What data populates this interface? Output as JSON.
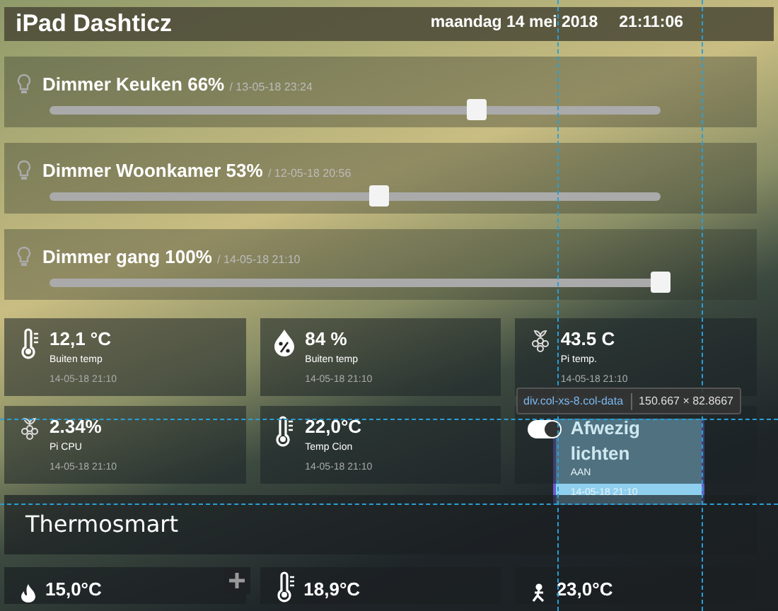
{
  "header": {
    "title": "iPad Dashticz",
    "date": "maandag 14 mei 2018",
    "time": "21:11:06"
  },
  "dimmers": [
    {
      "name": "Dimmer Keuken 66%",
      "updated": "/ 13-05-18 23:24",
      "level": 0.7
    },
    {
      "name": "Dimmer Woonkamer 53%",
      "updated": "/ 12-05-18 20:56",
      "level": 0.54
    },
    {
      "name": "Dimmer gang 100%",
      "updated": "/ 14-05-18 21:10",
      "level": 1.0
    }
  ],
  "tiles": [
    {
      "kind": "temperature",
      "value": "12,1 °C",
      "label": "Buiten temp",
      "updated": "14-05-18 21:10"
    },
    {
      "kind": "humidity",
      "value": "84 %",
      "label": "Buiten temp",
      "updated": "14-05-18 21:10"
    },
    {
      "kind": "pi",
      "value": "43.5 C",
      "label": "Pi temp.",
      "updated": "14-05-18 21:10"
    },
    {
      "kind": "pi",
      "value": "2.34%",
      "label": "Pi CPU",
      "updated": "14-05-18 21:10"
    },
    {
      "kind": "temperature",
      "value": "22,0°C",
      "label": "Temp Cion",
      "updated": "14-05-18 21:10"
    },
    {
      "kind": "switch",
      "on": true,
      "value": "Afwezig lichten",
      "label": "AAN",
      "updated": "14-05-18 21:10"
    }
  ],
  "section": {
    "title": "Thermosmart"
  },
  "bottom_tiles": [
    {
      "kind": "setpoint",
      "value": "15,0°C"
    },
    {
      "kind": "temperature",
      "value": "18,9°C"
    },
    {
      "kind": "presence",
      "value": "23,0°C"
    }
  ],
  "devtools_overlay": {
    "selector": "div.col-xs-8.col-data",
    "size": "150.667 × 82.8667"
  }
}
